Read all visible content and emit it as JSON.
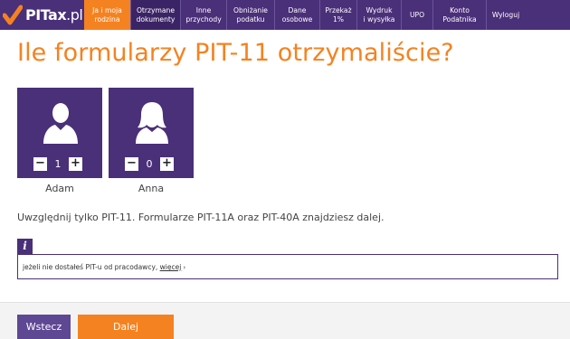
{
  "header": {
    "logo": {
      "brand": "PITax",
      "suffix": ".pl"
    },
    "nav": [
      {
        "label": "Ja i moja\nrodzina",
        "state": "current"
      },
      {
        "label": "Otrzymane\ndokumenty",
        "state": "selected"
      },
      {
        "label": "Inne\nprzychody",
        "state": "normal"
      },
      {
        "label": "Obniżanie\npodatku",
        "state": "normal"
      },
      {
        "label": "Dane\nosobowe",
        "state": "normal"
      },
      {
        "label": "Przekaż\n1%",
        "state": "normal"
      },
      {
        "label": "Wydruk\ni wysyłka",
        "state": "normal"
      },
      {
        "label": "UPO",
        "state": "normal"
      },
      {
        "label": "Konto\nPodatnika",
        "state": "normal"
      },
      {
        "label": "Wyloguj",
        "state": "normal"
      }
    ]
  },
  "main": {
    "title": "Ile formularzy PIT-11 otrzymaliście?",
    "persons": [
      {
        "name": "Adam",
        "count": "1",
        "icon": "male-user-icon"
      },
      {
        "name": "Anna",
        "count": "0",
        "icon": "female-user-icon"
      }
    ],
    "minus_label": "−",
    "plus_label": "+",
    "note": "Uwzględnij tylko PIT-11. Formularze PIT-11A oraz PIT-40A znajdziesz dalej.",
    "info": {
      "icon": "i",
      "text": "jeżeli nie dostałeś PIT-u od pracodawcy, ",
      "link": "więcej",
      "arrow": "›"
    }
  },
  "footer": {
    "back_label": "Wstecz",
    "next_label": "Dalej"
  },
  "colors": {
    "purple": "#4a2f79",
    "orange": "#f58220"
  }
}
